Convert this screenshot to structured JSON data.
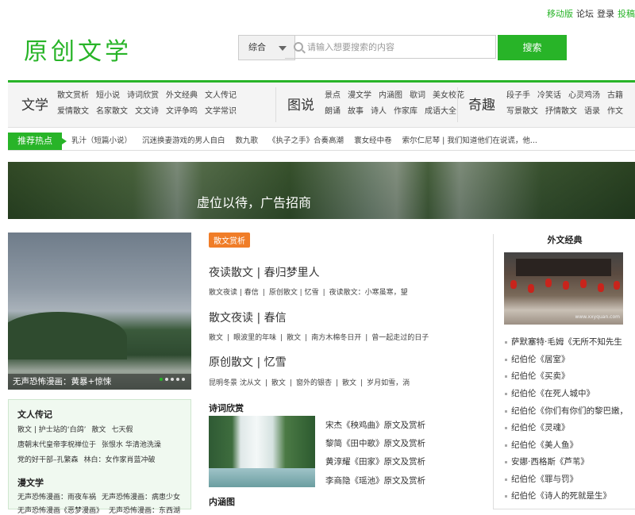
{
  "top_links": {
    "mobile": "移动版",
    "forum": "论坛",
    "login": "登录",
    "submit": "投稿"
  },
  "logo": {
    "text": "原创文学"
  },
  "search": {
    "category": "综合",
    "placeholder": "请输入想要搜索的内容",
    "button": "搜索"
  },
  "nav": [
    {
      "title": "文学",
      "rows": [
        [
          "散文赏析",
          "短小说",
          "诗词欣赏",
          "外文经典",
          "文人传记"
        ],
        [
          "爱情散文",
          "名家散文",
          "文文诗",
          "文评争鸣",
          "文学常识"
        ]
      ]
    },
    {
      "title": "图说",
      "rows": [
        [
          "景点",
          "漫文学",
          "内涵图",
          "歇词",
          "美女校花"
        ],
        [
          "朗诵",
          "故事",
          "诗人",
          "作家库",
          "成语大全"
        ]
      ]
    },
    {
      "title": "奇趣",
      "rows": [
        [
          "段子手",
          "冷笑话",
          "心灵鸡汤",
          "古籍"
        ],
        [
          "写景散文",
          "抒情散文",
          "语录",
          "作文"
        ]
      ]
    }
  ],
  "hot": {
    "label": "推荐热点",
    "items": [
      "乳汁（短篇小说）",
      "沉迷换妻游戏的男人自白",
      "数九歌",
      "《执子之手》合奏高潮",
      "寰女经中卷",
      "索尔仁尼琴 | 我们知道他们在说谎，他..."
    ]
  },
  "banner": {
    "text": "虚位以待，广告招商"
  },
  "slider": {
    "caption": "无声恐怖漫画：黄暴+惊悚"
  },
  "left_box": {
    "sec1_title": "文人传记",
    "sec1_lines": [
      [
        "散文 | 护士站的‘白鸽’",
        "散文",
        "七天假"
      ],
      [
        "唐朝末代皇帝李柷禅位于",
        "张恨水 华清池洗澡"
      ],
      [
        "党的好干部–孔繁森",
        "林白：女作家肖蓝冲破"
      ]
    ],
    "sec2_title": "漫文学",
    "sec2_lines": [
      [
        "无声恐怖漫画：雨夜车祸",
        "无声恐怖漫画：病患少女"
      ],
      [
        "无声恐怖漫画《恶梦漫画》",
        "无声恐怖漫画：东西湖"
      ]
    ]
  },
  "middle": {
    "tag": "散文赏析",
    "articles": [
      {
        "title": "夜读散文 | 春归梦里人",
        "links": [
          "散文夜读 | 春信",
          "原创散文 | 忆雪",
          "夜读散文：小寒虽寒，望"
        ]
      },
      {
        "title": "散文夜读 | 春信",
        "links": [
          "散文",
          "眼波里的年味",
          "散文",
          "南方木棉冬日开",
          "曾一起走过的日子"
        ]
      },
      {
        "title": "原创散文 | 忆雪",
        "links": [
          "昆明冬景 沈从文",
          "散文",
          "窗外的银杏",
          "散文",
          "岁月如雪，淌"
        ]
      }
    ],
    "poetry_title": "诗词欣赏",
    "poetry_links": [
      "宋杰《秧鸡曲》原文及赏析",
      "黎简《田中歌》原文及赏析",
      "黄淳耀《田家》原文及赏析",
      "李商隐《瑶池》原文及赏析"
    ],
    "neihan_title": "内涵图"
  },
  "right": {
    "title": "外文经典",
    "photo_watermark": "www.xxyquan.com",
    "list": [
      "萨默塞特·毛姆《无所不知先生",
      "纪伯伦《居室》",
      "纪伯伦《买卖》",
      "纪伯伦《在死人城中》",
      "纪伯伦《你们有你们的黎巴嫩，",
      "纪伯伦《灵魂》",
      "纪伯伦《美人鱼》",
      "安娜·西格斯《芦苇》",
      "纪伯伦《罪与罚》",
      "纪伯伦《诗人的死就是生》"
    ]
  }
}
